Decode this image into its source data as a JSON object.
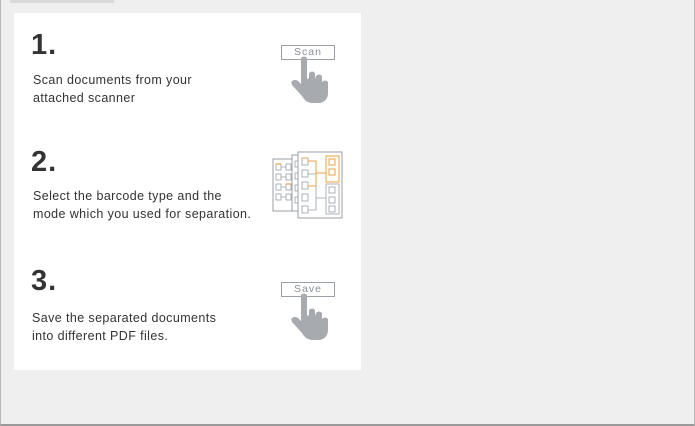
{
  "steps": [
    {
      "number": "1.",
      "line1": "Scan documents from your",
      "line2": "attached scanner",
      "button_label": "Scan",
      "icon": "hand-pointer-icon"
    },
    {
      "number": "2.",
      "line1": "Select the barcode type and the",
      "line2": "mode which you used for separation.",
      "icon": "document-separation-icon"
    },
    {
      "number": "3.",
      "line1": "Save the separated documents",
      "line2": "into different PDF files.",
      "button_label": "Save",
      "icon": "hand-pointer-icon"
    }
  ],
  "colors": {
    "accent": "#f0a040",
    "hand": "#a7abb0",
    "text": "#333333"
  }
}
